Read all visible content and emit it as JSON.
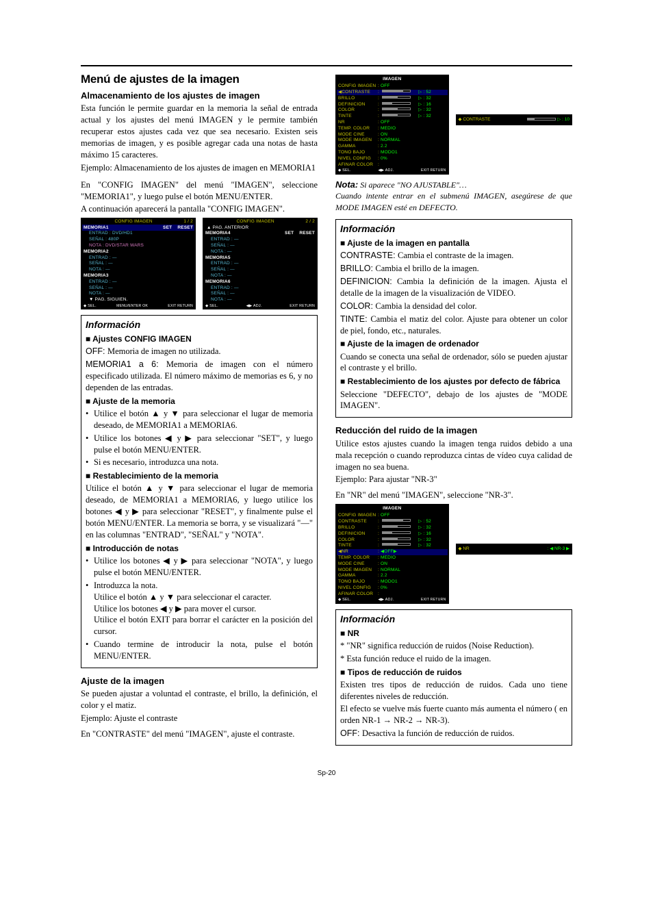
{
  "h1": "Menú de ajustes de la imagen",
  "h2a": "Almacenamiento de los ajustes de imagen",
  "pA1": "Esta función le permite guardar en la memoria la señal de entrada actual y los ajustes del menú IMAGEN y le permite también recuperar estos ajustes cada vez que sea necesario. Existen seis memorias de imagen, y es posible agregar cada una notas de hasta máximo 15 caracteres.",
  "pA2": "Ejemplo: Almacenamiento de los ajustes de imagen en MEMORIA1",
  "pA3": "En \"CONFIG IMAGEN\" del menú \"IMAGEN\", seleccione \"MEMORIA1\", y luego pulse el botón MENU/ENTER.",
  "pA4": "A continuación aparecerá la pantalla \"CONFIG IMAGEN\".",
  "osd1": {
    "title": "CONFIG IMAGEN",
    "page": "1 / 2",
    "m1": "MEMORIA1",
    "set": "SET",
    "reset": "RESET",
    "l1": "ENTRAD : DVD/HD1",
    "l2": "SEÑAL : 480P",
    "l3": "NOTA : DVD/STAR WARS",
    "m2": "MEMORIA2",
    "m3": "MEMORIA3",
    "e": "ENTRAD : —",
    "s": "SEÑAL : —",
    "n": "NOTA : —",
    "next": "▼ PAG. SIGUIEN.",
    "foot_l": "◆ SEL.",
    "foot_m": "MENU/ENTER OK",
    "foot_r": "EXIT RETURN"
  },
  "osd2": {
    "title": "CONFIG IMAGEN",
    "page": "2 / 2",
    "prev": "▲ PAG. ANTERIOR",
    "m4": "MEMORIA4",
    "m5": "MEMORIA5",
    "m6": "MEMORIA6",
    "set": "SET",
    "reset": "RESET",
    "e": "ENTRAD : —",
    "s": "SEÑAL : —",
    "n": "NOTA : —",
    "foot_l": "◆ SEL.",
    "foot_m": "◀▶ ADJ.",
    "foot_r": "EXIT RETURN"
  },
  "info1": {
    "title": "Información",
    "s1": "■ Ajustes CONFIG IMAGEN",
    "p1a": "OFF: ",
    "p1b": "Memoria de imagen no utilizada.",
    "p2a": "MEMORIA1 a 6: ",
    "p2b": "Memoria de imagen con el número especificado utilizada. El número máximo de memorias es 6, y no dependen de las entradas.",
    "s2": "■ Ajuste de la memoria",
    "b1": "Utilice el botón ▲ y ▼ para seleccionar el lugar de memoria deseado, de MEMORIA1 a MEMORIA6.",
    "b2": "Utilice los botones ◀ y ▶ para seleccionar \"SET\", y luego pulse el botón MENU/ENTER.",
    "b3": "Si es necesario, introduzca una nota.",
    "s3": "■ Restablecimiento de la memoria",
    "p3": "Utilice el botón ▲ y ▼ para seleccionar el lugar de memoria deseado, de MEMORIA1 a MEMORIA6, y luego utilice los botones ◀ y ▶ para seleccionar \"RESET\", y finalmente pulse el botón MENU/ENTER. La memoria se borra, y se visualizará \"—\" en las columnas \"ENTRAD\", \"SEÑAL\" y \"NOTA\".",
    "s4": "■ Introducción de notas",
    "b4": "Utilice los botones ◀ y ▶ para seleccionar \"NOTA\", y luego pulse el botón MENU/ENTER.",
    "b5a": "Introduzca la nota.",
    "b5b": "Utilice el botón ▲ y ▼ para seleccionar el caracter.",
    "b5c": "Utilice los botones ◀ y ▶ para mover el cursor.",
    "b5d": "Utilice el botón EXIT para borrar el carácter en la posición del cursor.",
    "b6": "Cuando termine de introducir la nota, pulse el botón MENU/ENTER."
  },
  "h2b": "Ajuste de la imagen",
  "pB1": "Se pueden ajustar a voluntad el contraste, el brillo, la definición, el color y el matiz.",
  "pB2": "Ejemplo: Ajuste el contraste",
  "pB3": "En \"CONTRASTE\" del menú \"IMAGEN\", ajuste el contraste.",
  "osd3": {
    "title": "IMAGEN",
    "rows": [
      {
        "l": "CONFIG IMAGEN",
        "v": "OFF"
      },
      {
        "l": "CONTRASTE",
        "v": "52",
        "slider": 75,
        "sel": true,
        "mark": "◀"
      },
      {
        "l": "BRILLO",
        "v": "32",
        "slider": 55
      },
      {
        "l": "DEFINICION",
        "v": "16",
        "slider": 35
      },
      {
        "l": "COLOR",
        "v": "32",
        "slider": 55
      },
      {
        "l": "TINTE",
        "v": "32",
        "slider": 55,
        "g": true
      },
      {
        "l": "NR",
        "v": "OFF"
      },
      {
        "l": "TEMP. COLOR",
        "v": "MEDIO"
      },
      {
        "l": "MODE CINE",
        "v": "ON"
      },
      {
        "l": "MODE IMAGEN",
        "v": "NORMAL"
      },
      {
        "l": "GAMMA",
        "v": "2.2"
      },
      {
        "l": "TONO BAJO",
        "v": "MODO1"
      },
      {
        "l": "NIVEL CONFIG",
        "v": "0%"
      },
      {
        "l": "AFINAR COLOR",
        "v": ""
      }
    ],
    "foot_l": "◆ SEL.",
    "foot_m": "◀▶ ADJ.",
    "foot_r": "EXIT RETURN"
  },
  "side1": {
    "l": "CONTRASTE",
    "icon": "◆",
    "v": "10",
    "slider": 25,
    "arrows": "◆"
  },
  "nota": {
    "label": "Nota:",
    "tail": " Si aparece \"NO AJUSTABLE\"…",
    "line2": "Cuando intente entrar en el submenú IMAGEN, asegúrese de que MODE IMAGEN esté en DEFECTO."
  },
  "info2": {
    "title": "Información",
    "s1": "■ Ajuste de la imagen en pantalla",
    "l1a": "CONTRASTE: ",
    "l1b": "Cambia el contraste de la imagen.",
    "l2a": "BRILLO: ",
    "l2b": "Cambia el brillo de la imagen.",
    "l3a": "DEFINICION: ",
    "l3b": "Cambia la definición de la imagen. Ajusta el detalle de la imagen de la visualización de VIDEO.",
    "l4a": "COLOR: ",
    "l4b": "Cambia la densidad del color.",
    "l5a": "TINTE: ",
    "l5b": "Cambia el matiz del color. Ajuste para obtener un color de piel, fondo, etc., naturales.",
    "s2": "■ Ajuste de la imagen de ordenador",
    "p2": "Cuando se conecta una señal de ordenador, sólo se pueden ajustar el contraste y el brillo.",
    "s3": "■ Restablecimiento de los ajustes por defecto de fábrica",
    "p3": "Seleccione \"DEFECTO\", debajo de los ajustes de \"MODE IMAGEN\"."
  },
  "h2c": "Reducción del ruido de la imagen",
  "pC1": "Utilice estos ajustes cuando la imagen tenga ruidos debido a una mala recepción o cuando reproduzca cintas de vídeo cuya calidad de imagen no sea buena.",
  "pC2": "Ejemplo: Para ajustar \"NR-3\"",
  "pC3": "En \"NR\" del menú \"IMAGEN\", seleccione \"NR-3\".",
  "osd4": {
    "title": "IMAGEN",
    "rows": [
      {
        "l": "CONFIG IMAGEN",
        "v": "OFF"
      },
      {
        "l": "CONTRASTE",
        "v": "52",
        "slider": 75
      },
      {
        "l": "BRILLO",
        "v": "32",
        "slider": 55
      },
      {
        "l": "DEFINICION",
        "v": "16",
        "slider": 35
      },
      {
        "l": "COLOR",
        "v": "32",
        "slider": 55
      },
      {
        "l": "TINTE",
        "v": "32",
        "slider": 55,
        "g": true
      },
      {
        "l": "NR",
        "v": "◀OFF▶",
        "sel": true,
        "mark": "◀"
      },
      {
        "l": "TEMP. COLOR",
        "v": "MEDIO"
      },
      {
        "l": "MODE CINE",
        "v": "ON"
      },
      {
        "l": "MODE IMAGEN",
        "v": "NORMAL"
      },
      {
        "l": "GAMMA",
        "v": "2.2"
      },
      {
        "l": "TONO BAJO",
        "v": "MODO1"
      },
      {
        "l": "NIVEL CONFIG",
        "v": "0%"
      },
      {
        "l": "AFINAR COLOR",
        "v": ""
      }
    ],
    "foot_l": "◆ SEL.",
    "foot_m": "◀▶ ADJ.",
    "foot_r": "EXIT RETURN"
  },
  "side2": {
    "l": "NR",
    "icon": "◆",
    "v": "◀ NR-3 ▶"
  },
  "info3": {
    "title": "Información",
    "s1": "■ NR",
    "p1": "* \"NR\" significa reducción de ruidos (Noise Reduction).",
    "p2": "* Esta función reduce el ruido de la imagen.",
    "s2": "■ Tipos de reducción de ruidos",
    "p3": "Existen tres tipos de reducción de ruidos. Cada uno tiene diferentes niveles de reducción.",
    "p4": "El efecto se vuelve más fuerte cuanto más aumenta el número ( en orden NR-1 → NR-2 → NR-3).",
    "p5a": "OFF: ",
    "p5b": "Desactiva la función de reducción de ruidos."
  },
  "footer": "Sp-20"
}
